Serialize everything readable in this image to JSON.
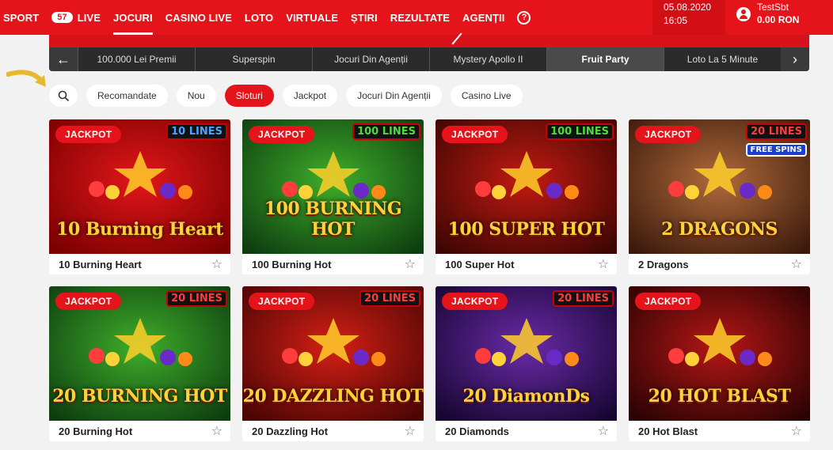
{
  "nav": {
    "items": [
      {
        "label": "SPORT",
        "active": false
      },
      {
        "label": "LIVE",
        "badge": "57",
        "active": false
      },
      {
        "label": "JOCURI",
        "active": true
      },
      {
        "label": "CASINO LIVE",
        "active": false
      },
      {
        "label": "LOTO",
        "active": false
      },
      {
        "label": "VIRTUALE",
        "active": false
      },
      {
        "label": "ȘTIRI",
        "active": false
      },
      {
        "label": "REZULTATE",
        "active": false
      },
      {
        "label": "AGENȚII",
        "active": false
      }
    ],
    "help_icon": "question-circle-icon"
  },
  "datetime": {
    "date": "05.08.2020",
    "time": "16:05"
  },
  "user": {
    "name": "TestSbt",
    "balance": "0.00 RON",
    "icon": "user-circle-icon"
  },
  "carousel": {
    "items": [
      "100.000 Lei Premii",
      "Superspin",
      "Jocuri Din Agenții",
      "Mystery Apollo II",
      "Fruit Party",
      "Loto La 5 Minute"
    ],
    "active_index": 4
  },
  "filters": {
    "search_icon": "search-icon",
    "items": [
      "Recomandate",
      "Nou",
      "Sloturi",
      "Jackpot",
      "Jocuri Din Agenții",
      "Casino Live"
    ],
    "active_index": 2
  },
  "games": [
    {
      "name": "10 Burning Heart",
      "badge": "JACKPOT",
      "lines": "10 LINES",
      "art": "10 Burning Heart",
      "bg": [
        "#e3161a",
        "#7a0000"
      ],
      "lines_color": "#4aa3ff"
    },
    {
      "name": "100 Burning Hot",
      "badge": "JACKPOT",
      "lines": "100 LINES",
      "art": "100 BURNING HOT",
      "bg": [
        "#3fae2a",
        "#0d3d10"
      ],
      "lines_color": "#4ddc3b"
    },
    {
      "name": "100 Super Hot",
      "badge": "JACKPOT",
      "lines": "100 LINES",
      "art": "100 SUPER HOT",
      "bg": [
        "#c21a12",
        "#3d0603"
      ],
      "lines_color": "#4ddc3b"
    },
    {
      "name": "2 Dragons",
      "badge": "JACKPOT",
      "lines": "20 LINES",
      "extra": "FREE SPINS",
      "art": "2 DRAGONS",
      "bg": [
        "#b06a3a",
        "#3b1a0c"
      ],
      "lines_color": "#ff3b3b"
    },
    {
      "name": "20 Burning Hot",
      "badge": "JACKPOT",
      "lines": "20 LINES",
      "art": "20 BURNING HOT",
      "bg": [
        "#3fae2a",
        "#0d3d10"
      ],
      "lines_color": "#ff3b3b"
    },
    {
      "name": "20 Dazzling Hot",
      "badge": "JACKPOT",
      "lines": "20 LINES",
      "art": "20 DAZZLING HOT",
      "bg": [
        "#d41f14",
        "#4a0505"
      ],
      "lines_color": "#ff3b3b"
    },
    {
      "name": "20 Diamonds",
      "badge": "JACKPOT",
      "lines": "20 LINES",
      "art": "20 DiamonDs",
      "bg": [
        "#6a2aa8",
        "#160630"
      ],
      "lines_color": "#ff3b3b"
    },
    {
      "name": "20 Hot Blast",
      "badge": "JACKPOT",
      "lines": "",
      "art": "20 HOT BLAST",
      "bg": [
        "#b51616",
        "#2a0303"
      ],
      "lines_color": "#ff3b3b"
    }
  ],
  "colors": {
    "brand": "#e5141b",
    "carousel_bg": "#2b2b2b",
    "page_bg": "#f2f2f2"
  }
}
